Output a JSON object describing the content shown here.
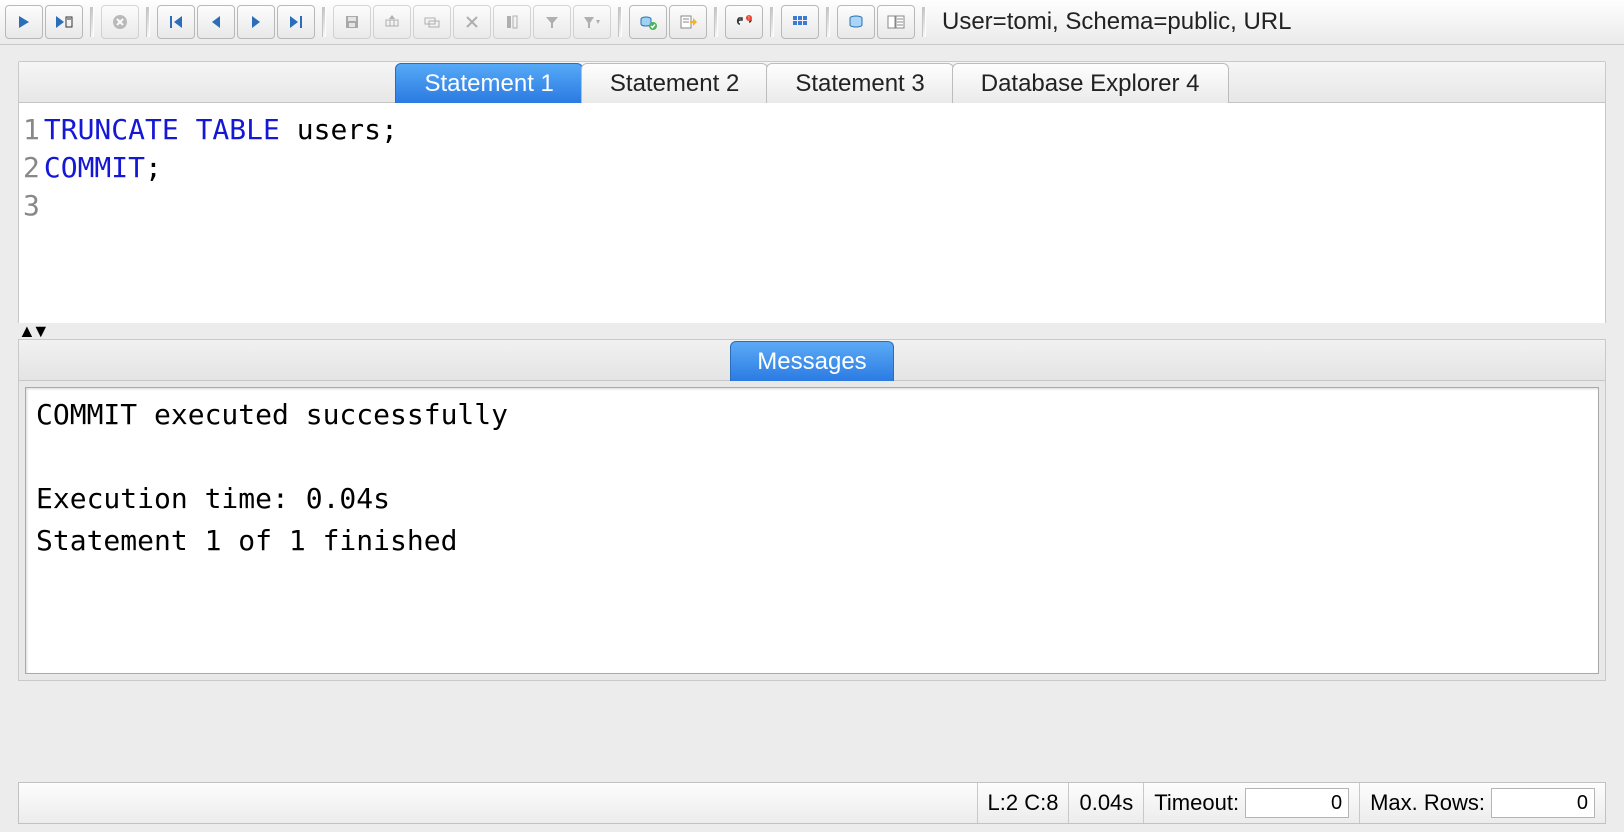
{
  "toolbar": {
    "connection_label": "User=tomi, Schema=public, URL",
    "buttons": [
      {
        "name": "execute-icon"
      },
      {
        "name": "execute-cursor-icon"
      },
      {
        "name": "stop-icon",
        "disabled": true
      },
      {
        "name": "first-icon"
      },
      {
        "name": "prev-icon"
      },
      {
        "name": "next-icon"
      },
      {
        "name": "last-icon"
      },
      {
        "name": "save-icon",
        "disabled": true
      },
      {
        "name": "insert-row-icon",
        "disabled": true
      },
      {
        "name": "copy-row-icon",
        "disabled": true
      },
      {
        "name": "delete-row-icon",
        "disabled": true
      },
      {
        "name": "pin-icon",
        "disabled": true
      },
      {
        "name": "filter-icon",
        "disabled": true
      },
      {
        "name": "filter-drop-icon",
        "disabled": true
      },
      {
        "name": "commit-icon"
      },
      {
        "name": "rollback-icon"
      },
      {
        "name": "disconnect-icon"
      },
      {
        "name": "ignore-errors-icon"
      },
      {
        "name": "db-browser-icon"
      },
      {
        "name": "object-list-icon"
      }
    ]
  },
  "tabs": [
    {
      "label": "Statement 1",
      "active": true
    },
    {
      "label": "Statement 2",
      "active": false
    },
    {
      "label": "Statement 3",
      "active": false
    },
    {
      "label": "Database Explorer 4",
      "active": false
    }
  ],
  "editor": {
    "lines": [
      {
        "num": "1",
        "kw": "TRUNCATE TABLE",
        "rest": " users;"
      },
      {
        "num": "2",
        "kw": "COMMIT",
        "rest": ";"
      },
      {
        "num": "3",
        "kw": "",
        "rest": ""
      }
    ]
  },
  "messages": {
    "tab_label": "Messages",
    "body": "COMMIT executed successfully\n\nExecution time: 0.04s\nStatement 1 of 1 finished\n"
  },
  "status": {
    "cursor": "L:2 C:8",
    "exec_time": "0.04s",
    "timeout_label": "Timeout:",
    "timeout_value": "0",
    "maxrows_label": "Max. Rows:",
    "maxrows_value": "0"
  }
}
